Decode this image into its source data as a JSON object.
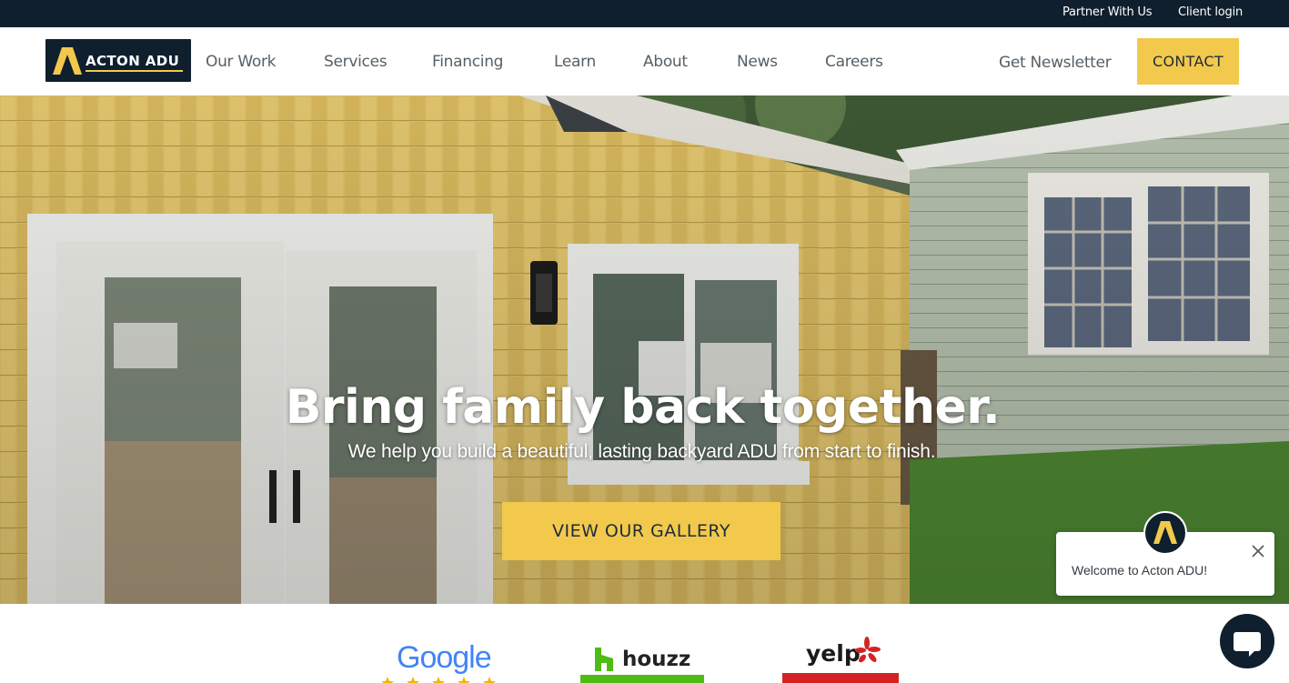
{
  "topbar": {
    "partner": "Partner With Us",
    "client_login": "Client login"
  },
  "logo": {
    "text": "ACTON ADU"
  },
  "nav": {
    "items": [
      "Our Work",
      "Services",
      "Financing",
      "Learn",
      "About",
      "News",
      "Careers"
    ],
    "newsletter": "Get Newsletter",
    "contact": "CONTACT"
  },
  "hero": {
    "title": "Bring family back together.",
    "subtitle": "We help you build a beautiful, lasting backyard ADU from start to finish.",
    "cta": "VIEW OUR GALLERY"
  },
  "chat": {
    "welcome": "Welcome to Acton ADU!"
  },
  "reviews": {
    "google": "Google",
    "houzz": "houzz",
    "yelp": "yelp"
  },
  "colors": {
    "navy": "#0f1f2e",
    "accent_yellow": "#f2c94c",
    "nav_text": "#555f66"
  }
}
